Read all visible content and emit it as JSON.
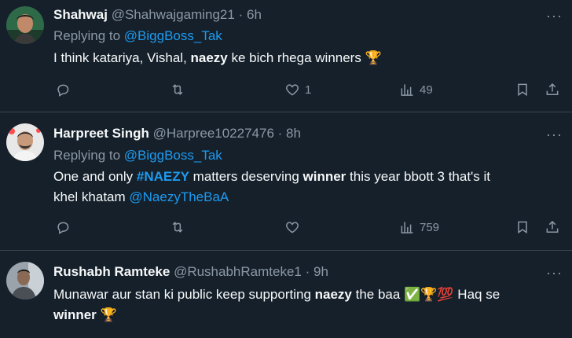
{
  "tweets": [
    {
      "name": "Shahwaj",
      "handle": "@Shahwajgaming21",
      "sep": "·",
      "time": "6h",
      "replying_prefix": "Replying to",
      "replying_to": "@BiggBoss_Tak",
      "body": {
        "p1": "I think katariya, Vishal, ",
        "b1": "naezy",
        "p2": " ke bich rhega winners ",
        "emoji": "🏆"
      },
      "stats": {
        "likes": "1",
        "views": "49"
      }
    },
    {
      "name": "Harpreet Singh",
      "handle": "@Harpree10227476",
      "sep": "·",
      "time": "8h",
      "replying_prefix": "Replying to",
      "replying_to": "@BiggBoss_Tak",
      "body": {
        "p1": "One and only ",
        "hashtag": "#NAEZY",
        "p2": " matters deserving ",
        "b1": "winner",
        "p3": " this year bbott 3 that's it",
        "line2": "khel khatam ",
        "mention": "@NaezyTheBaA"
      },
      "stats": {
        "likes": "",
        "views": "759"
      }
    },
    {
      "name": "Rushabh Ramteke",
      "handle": "@RushabhRamteke1",
      "sep": "·",
      "time": "9h",
      "body": {
        "p1": "Munawar aur stan ki public keep supporting ",
        "b1": "naezy",
        "p2": " the baa ",
        "emojis": "✅🏆💯",
        "p3": " Haq se",
        "b2": "winner",
        "emoji2": "🏆"
      }
    }
  ],
  "icons": {
    "more": "ellipsis-icon",
    "reply": "reply-icon",
    "retweet": "retweet-icon",
    "like": "heart-icon",
    "views": "views-icon",
    "bookmark": "bookmark-icon",
    "share": "share-icon"
  },
  "colors": {
    "background": "#15202b",
    "link": "#1d9bf0",
    "muted": "#8b98a5",
    "divider": "#38444d"
  }
}
